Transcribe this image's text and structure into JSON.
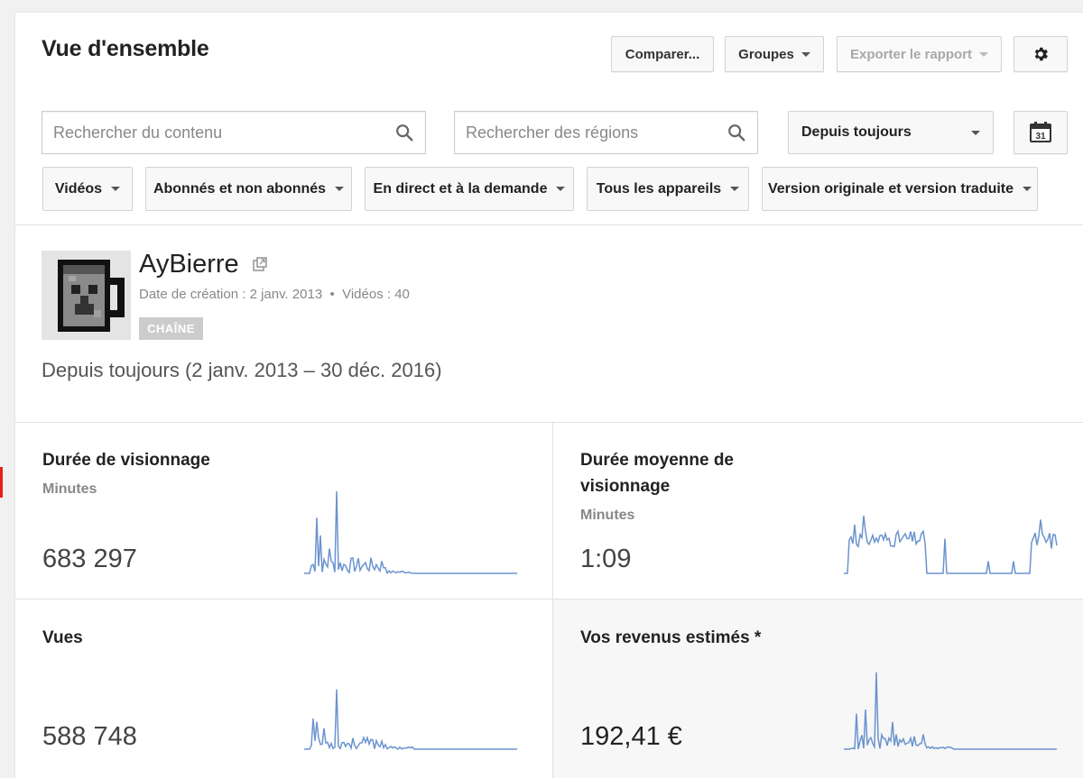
{
  "header": {
    "title": "Vue d'ensemble",
    "compare_label": "Comparer...",
    "groups_label": "Groupes",
    "export_label": "Exporter le rapport",
    "settings_icon": "gear-icon"
  },
  "search": {
    "content_placeholder": "Rechercher du contenu",
    "regions_placeholder": "Rechercher des régions",
    "icon": "search-icon"
  },
  "date_range": {
    "selected": "Depuis toujours",
    "calendar_label": "31",
    "calendar_icon": "calendar-icon"
  },
  "filters": [
    {
      "label": "Vidéos"
    },
    {
      "label": "Abonnés et non abonnés"
    },
    {
      "label": "En direct et à la demande"
    },
    {
      "label": "Tous les appareils"
    },
    {
      "label": "Version originale et version traduite"
    }
  ],
  "channel": {
    "name": "AyBierre",
    "meta": "Date de création : 2 janv. 2013  •  Vidéos : 40",
    "badge": "CHAÎNE",
    "period": "Depuis toujours (2 janv. 2013 – 30 déc. 2016)"
  },
  "metrics": [
    {
      "title": "Durée de visionnage",
      "subtitle": "Minutes",
      "value": "683 297"
    },
    {
      "title": "Durée moyenne de visionnage",
      "subtitle": "Minutes",
      "value": "1:09"
    },
    {
      "title": "Vues",
      "subtitle": "",
      "value": "588 748"
    },
    {
      "title": "Vos revenus estimés *",
      "subtitle": "",
      "value": "192,41 €"
    }
  ],
  "colors": {
    "spark": "#6b93cf",
    "accent": "#e62117"
  }
}
